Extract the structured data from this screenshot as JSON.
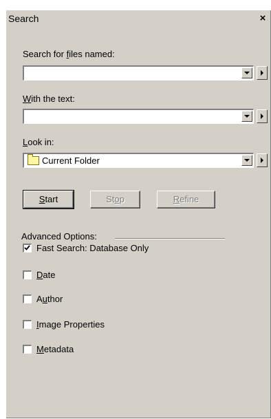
{
  "panel": {
    "title": "Search",
    "close_glyph": "×"
  },
  "search_named": {
    "label_pre": "Search for ",
    "label_u": "f",
    "label_post": "iles named:",
    "value": ""
  },
  "with_text": {
    "label_u": "W",
    "label_post": "ith the text:",
    "value": ""
  },
  "look_in": {
    "label_u": "L",
    "label_post": "ook in:",
    "value": "Current Folder",
    "icon": "folder-icon"
  },
  "buttons": {
    "start_u": "S",
    "start_post": "tart",
    "stop_pre": "St",
    "stop_u": "o",
    "stop_post": "p",
    "refine_u": "R",
    "refine_post": "efine"
  },
  "advanced": {
    "heading": "Advanced Options:",
    "options": [
      {
        "pre": "",
        "u": "",
        "post": "Fast Search: Database Only",
        "checked": true
      },
      {
        "pre": "",
        "u": "D",
        "post": "ate",
        "checked": false
      },
      {
        "pre": "A",
        "u": "u",
        "post": "thor",
        "checked": false
      },
      {
        "pre": "",
        "u": "I",
        "post": "mage Properties",
        "checked": false
      },
      {
        "pre": "",
        "u": "M",
        "post": "etadata",
        "checked": false
      }
    ]
  }
}
